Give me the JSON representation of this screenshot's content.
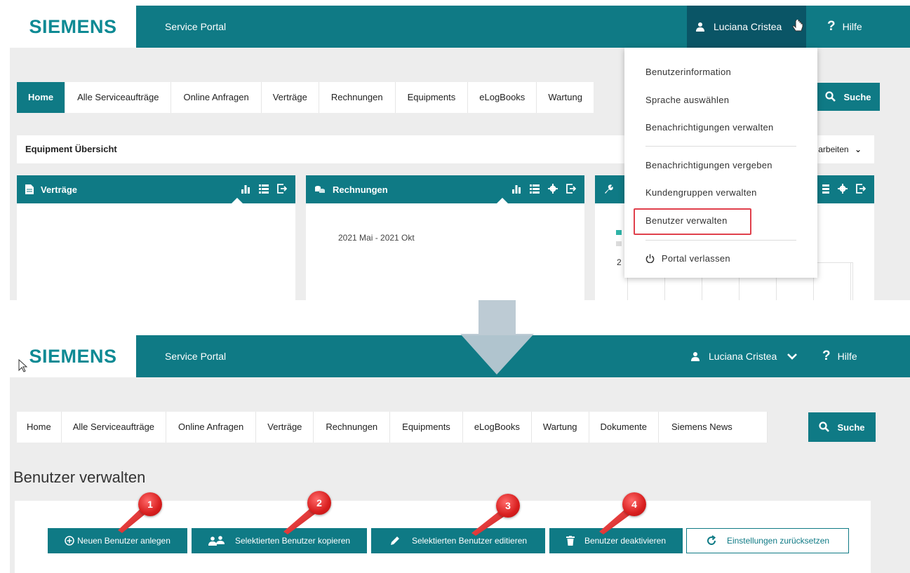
{
  "brand": {
    "logo": "SIEMENS",
    "portal": "Service Portal"
  },
  "user": {
    "name": "Luciana Cristea"
  },
  "help": {
    "label": "Hilfe",
    "icon": "question-icon"
  },
  "nav": {
    "items": [
      "Home",
      "Alle Serviceaufträge",
      "Online Anfragen",
      "Verträge",
      "Rechnungen",
      "Equipments",
      "eLogBooks",
      "Wartung",
      "Dokumente",
      "Siemens News"
    ],
    "active": "Home",
    "search_label": "Suche"
  },
  "top": {
    "overview_title": "Equipment Übersicht",
    "overview_action": "arbeiten",
    "widgets": {
      "vertraege": {
        "title": "Verträge"
      },
      "rechnungen": {
        "title": "Rechnungen",
        "period": "2021 Mai - 2021 Okt"
      },
      "third": {
        "partial_text": "2"
      }
    },
    "user_menu": {
      "items": [
        "Benutzerinformation",
        "Sprache auswählen",
        "Benachrichtigungen verwalten",
        "Benachrichtigungen vergeben",
        "Kundengruppen verwalten",
        "Benutzer verwalten"
      ],
      "highlighted": "Benutzer verwalten",
      "logout": "Portal verlassen"
    }
  },
  "bottom": {
    "page_title": "Benutzer verwalten",
    "buttons": {
      "new_user": "Neuen Benutzer anlegen",
      "copy_user": "Selektierten Benutzer kopieren",
      "edit_user": "Selektierten Benutzer editieren",
      "deactivate_user": "Benutzer deaktivieren",
      "reset": "Einstellungen zurücksetzen"
    },
    "badges": [
      "1",
      "2",
      "3",
      "4"
    ]
  },
  "colors": {
    "teal": "#0f7a85",
    "highlight": "#e0404c",
    "badge": "#d81e1e",
    "arrow": "#b9c8d2"
  }
}
